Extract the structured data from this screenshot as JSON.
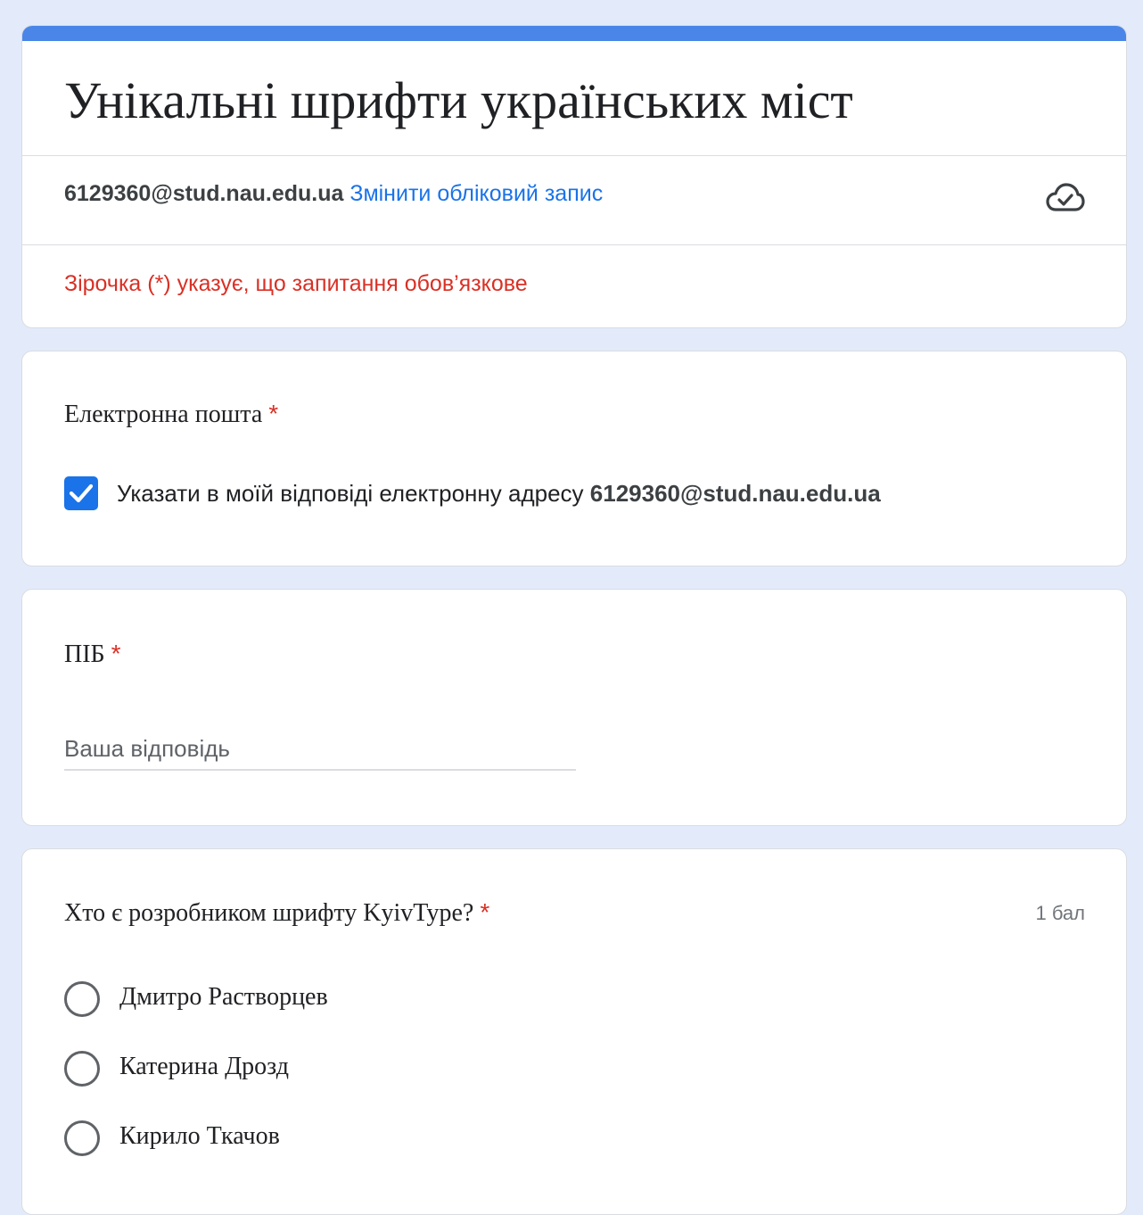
{
  "header": {
    "title": "Унікальні шрифти українських міст",
    "account_email": "6129360@stud.nau.edu.ua",
    "switch_account": "Змінити обліковий запис",
    "required_note": "Зірочка (*) указує, що запитання обов’язкове",
    "accent_color": "#4a86e8"
  },
  "email_question": {
    "title": "Електронна пошта",
    "required_mark": "*",
    "checkbox_checked": true,
    "checkbox_label": "Указати в моїй відповіді електронну адресу",
    "checkbox_email": "6129360@stud.nau.edu.ua"
  },
  "name_question": {
    "title": "ПІБ",
    "required_mark": "*",
    "placeholder": "Ваша відповідь"
  },
  "quiz_question": {
    "title": "Хто є розробником шрифту KyivType?",
    "required_mark": "*",
    "points": "1 бал",
    "options": [
      "Дмитро Растворцев",
      "Катерина Дрозд",
      "Кирило Ткачов"
    ]
  }
}
